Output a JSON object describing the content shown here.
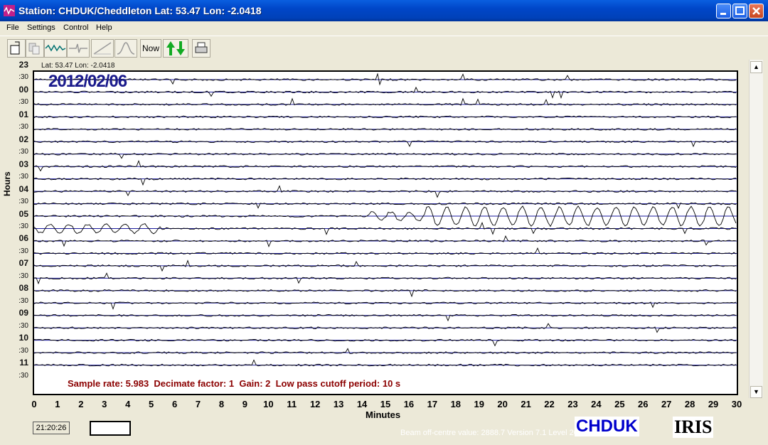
{
  "window": {
    "title": "Station: CHDUK/Cheddleton Lat: 53.47 Lon: -2.0418"
  },
  "menu": {
    "file": "File",
    "settings": "Settings",
    "control": "Control",
    "help": "Help"
  },
  "toolbar": {
    "now_label": "Now"
  },
  "plot": {
    "latlon": "Lat: 53.47 Lon: -2.0418",
    "date": "2012/02/06",
    "hour_labels": [
      "23",
      ":30",
      "00",
      ":30",
      "01",
      ":30",
      "02",
      ":30",
      "03",
      ":30",
      "04",
      ":30",
      "05",
      ":30",
      "06",
      ":30",
      "07",
      ":30",
      "08",
      ":30",
      "09",
      ":30",
      "10",
      ":30",
      "11",
      ":30"
    ],
    "y_axis_title": "Hours",
    "minute_labels": [
      "0",
      "1",
      "2",
      "3",
      "4",
      "5",
      "6",
      "7",
      "8",
      "9",
      "10",
      "11",
      "12",
      "13",
      "14",
      "15",
      "16",
      "17",
      "18",
      "19",
      "20",
      "21",
      "22",
      "23",
      "24",
      "25",
      "26",
      "27",
      "28",
      "29",
      "30"
    ],
    "x_axis_title": "Minutes",
    "info": "Sample rate: 5.983  Decimate factor: 1  Gain: 2  Low pass cutoff period: 10 s"
  },
  "status": {
    "time": "21:20:26",
    "beam": "Beam off-centre value: 2888.7   Version 7.1 Level 2011.08.31",
    "station_code": "CHDUK",
    "logo": "IRIS"
  },
  "colors": {
    "trace": "#000000",
    "baseline": "#1c1c9c",
    "title_blue": "#0046c8",
    "info_red": "#8b0000"
  }
}
